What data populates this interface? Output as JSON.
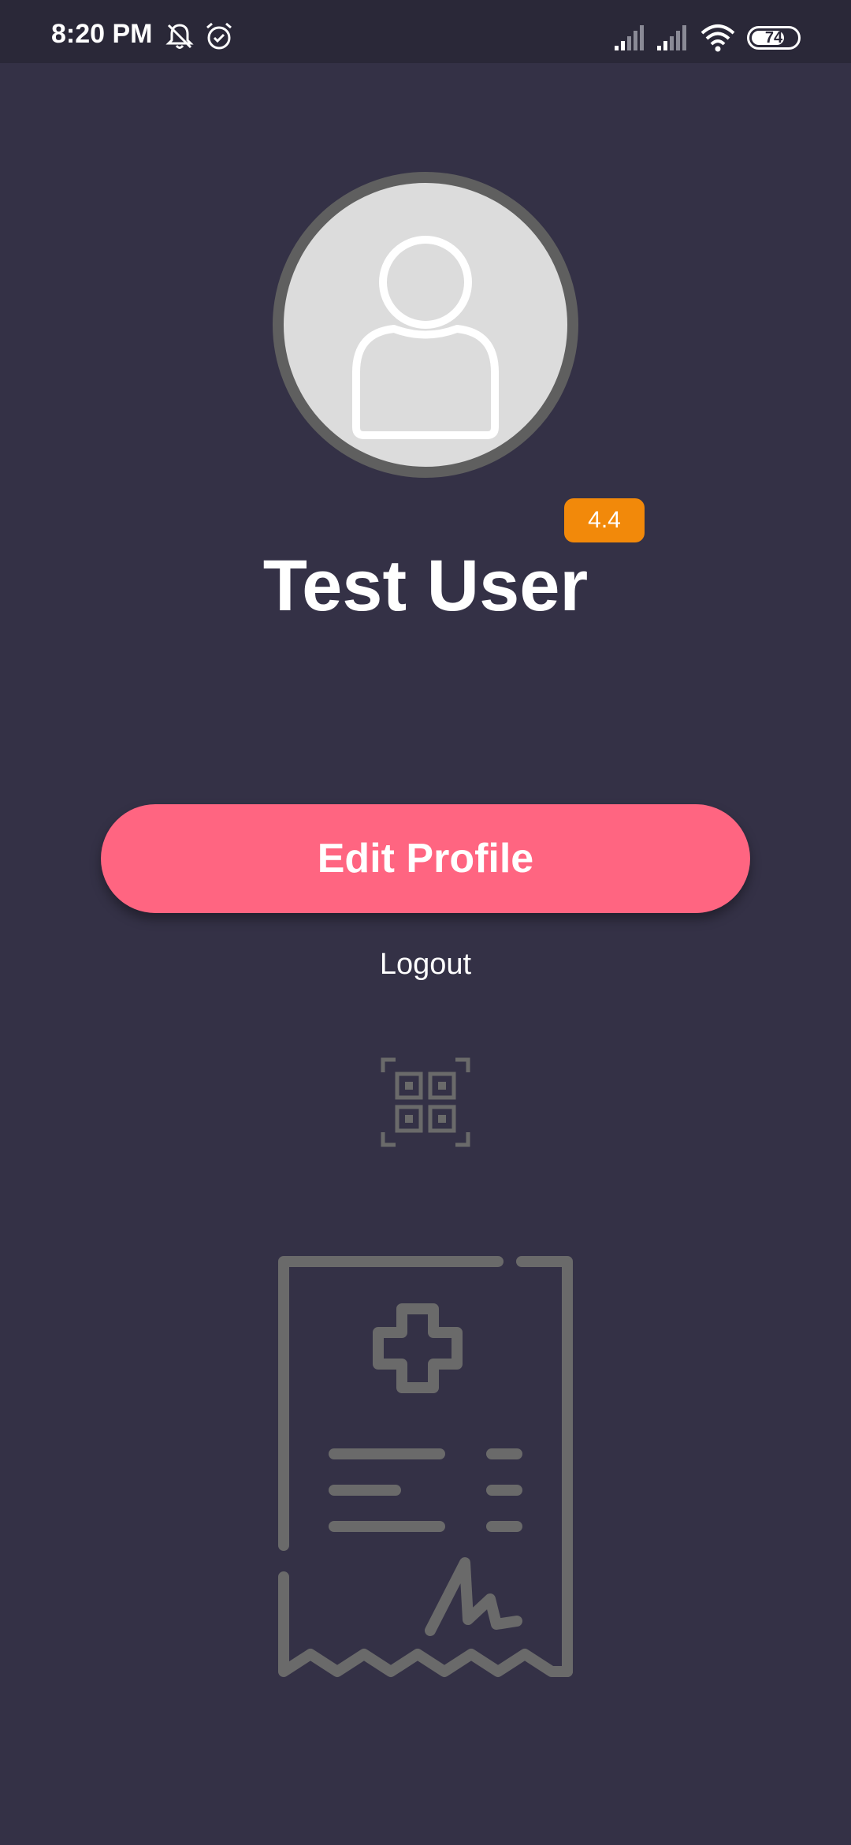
{
  "status_bar": {
    "time": "8:20 PM",
    "battery": "74",
    "battery_level": 0.74,
    "icons": [
      "mute-icon",
      "alarm-icon",
      "signal-icon",
      "signal-icon",
      "wifi-icon",
      "battery-icon"
    ]
  },
  "profile": {
    "avatar": "user-icon",
    "rating": "4.4",
    "name": "Test User"
  },
  "actions": {
    "edit_profile": "Edit Profile",
    "logout": "Logout"
  },
  "icons": {
    "qr": "qr-code-icon",
    "prescription": "prescription-icon"
  },
  "colors": {
    "background": "#343146",
    "status_bar": "#2a2838",
    "accent": "#ff6581",
    "badge": "#f2890a",
    "icon_gray": "#6a6a6a"
  }
}
